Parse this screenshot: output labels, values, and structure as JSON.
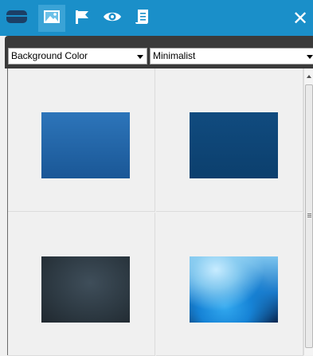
{
  "toolbar": {
    "tabs": [
      {
        "icon": "layers-icon"
      },
      {
        "icon": "image-icon",
        "active": true
      },
      {
        "icon": "flag-icon"
      },
      {
        "icon": "eye-icon"
      },
      {
        "icon": "script-icon"
      }
    ],
    "close_label": "✕"
  },
  "filters": {
    "category": "Background Color",
    "style": "Minimalist"
  },
  "thumbnails": [
    {
      "name": "blue-gradient",
      "colors": [
        "#2a6fb3",
        "#1a5796"
      ]
    },
    {
      "name": "dark-blue",
      "colors": [
        "#0f4a7d",
        "#0c3f6d"
      ]
    },
    {
      "name": "slate",
      "colors": [
        "#3a4853",
        "#242e36"
      ]
    },
    {
      "name": "bokeh-blue",
      "colors": [
        "#8fd0f2",
        "#0a2a55"
      ]
    }
  ],
  "colors": {
    "toolbar_bg": "#1a8fc9",
    "toolbar_active": "#3aa3d6",
    "filter_bar": "#3a3a3a",
    "panel_bg": "#f0f0f0"
  }
}
